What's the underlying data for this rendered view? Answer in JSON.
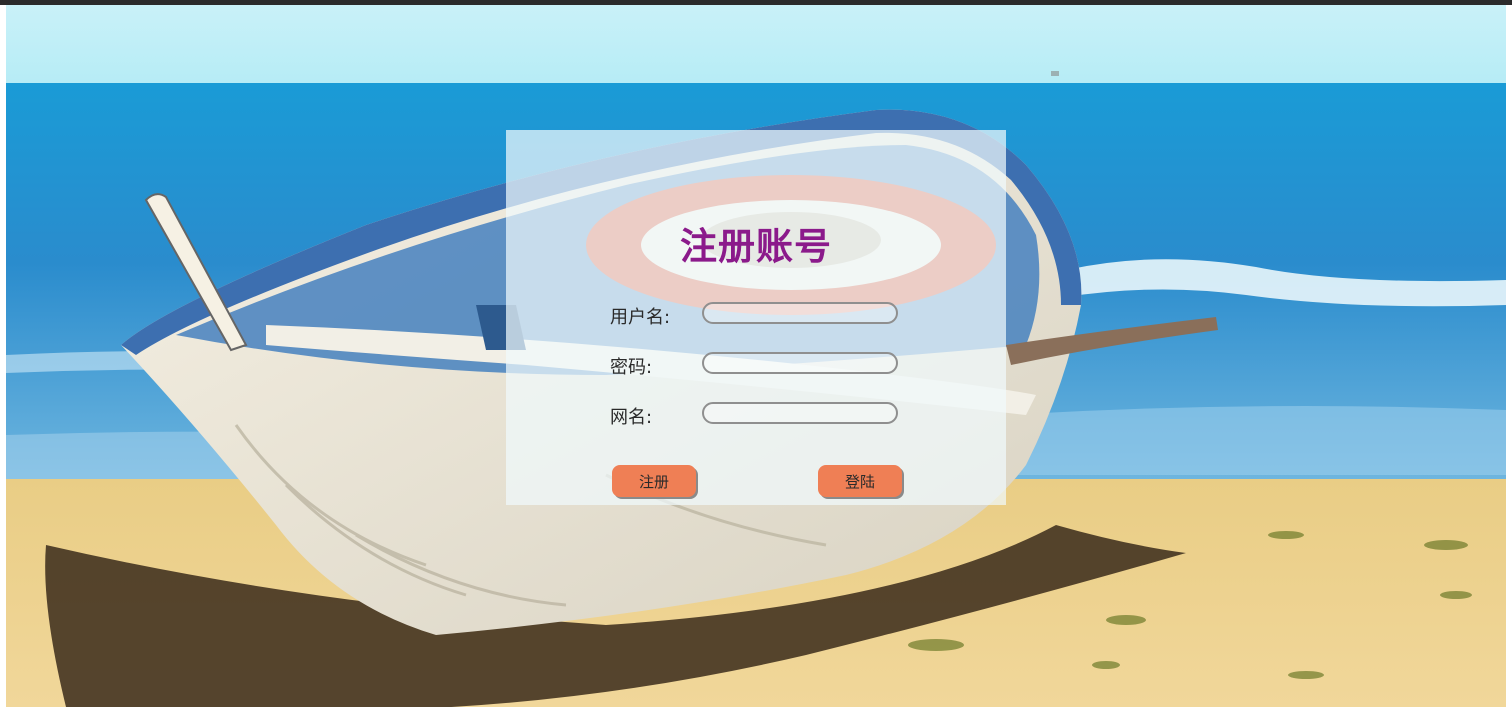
{
  "form": {
    "title": "注册账号",
    "fields": [
      {
        "label": "用户名:",
        "value": "",
        "placeholder": ""
      },
      {
        "label": "密码:",
        "value": "",
        "placeholder": ""
      },
      {
        "label": "网名:",
        "value": "",
        "placeholder": ""
      }
    ],
    "register_label": "注册",
    "login_label": "登陆"
  },
  "colors": {
    "title": "#8b1a8b",
    "button": "#ef7f55"
  }
}
